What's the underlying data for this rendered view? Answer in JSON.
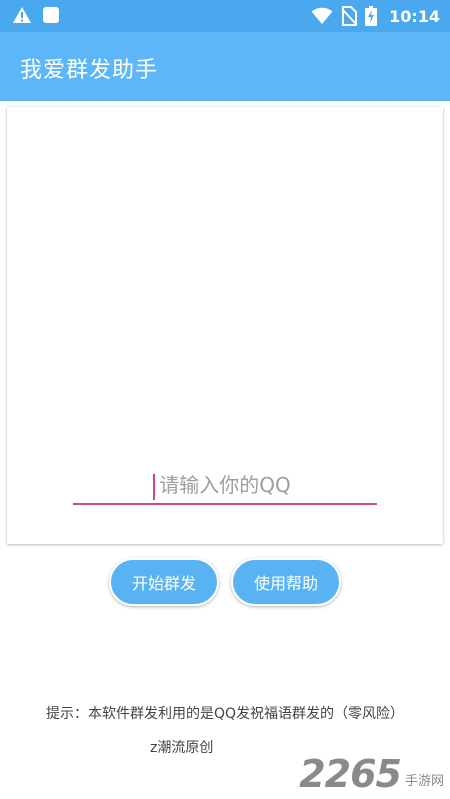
{
  "status_bar": {
    "time": "10:14",
    "icons": [
      "warning-icon",
      "square-notification-icon",
      "wifi-icon",
      "no-sim-icon",
      "battery-charging-icon"
    ]
  },
  "app_bar": {
    "title": "我爱群发助手"
  },
  "qq_input": {
    "placeholder": "请输入你的QQ",
    "value": ""
  },
  "buttons": {
    "start": "开始群发",
    "help": "使用帮助"
  },
  "footer": {
    "tip": "提示：本软件群发利用的是QQ发祝福语群发的（零风险）",
    "credit": "z潮流原创"
  },
  "watermark": {
    "big": "2265",
    "small": "手游网"
  },
  "colors": {
    "status_bar": "#4aa8ee",
    "app_bar": "#5cb6f7",
    "button": "#59b3f3",
    "input_underline": "#d6457e"
  }
}
